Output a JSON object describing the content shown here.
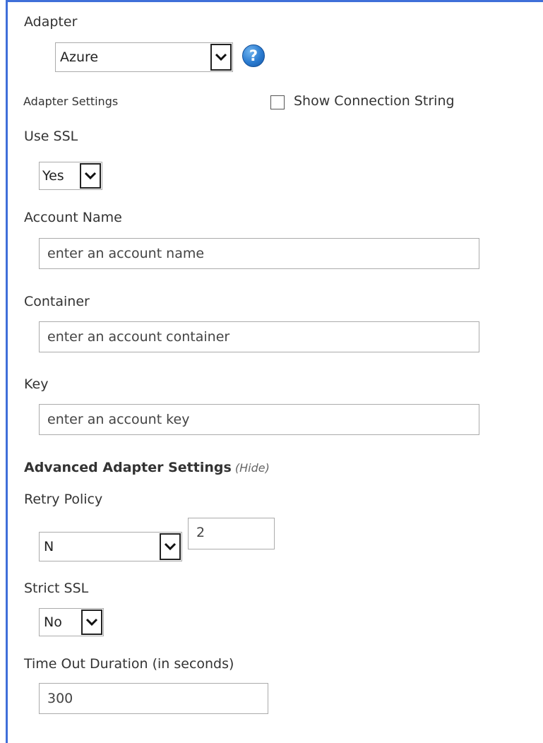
{
  "adapter": {
    "label": "Adapter",
    "selected": "Azure",
    "help_icon": "help-icon"
  },
  "adapter_settings": {
    "label": "Adapter Settings",
    "show_connection_string_label": "Show Connection String",
    "show_connection_string_checked": false
  },
  "use_ssl": {
    "label": "Use SSL",
    "selected": "Yes"
  },
  "account_name": {
    "label": "Account Name",
    "placeholder": "enter an account name"
  },
  "container": {
    "label": "Container",
    "placeholder": "enter an account container"
  },
  "key": {
    "label": "Key",
    "placeholder": "enter an account key"
  },
  "advanced": {
    "heading": "Advanced Adapter Settings",
    "toggle_label": "(Hide)"
  },
  "retry_policy": {
    "label": "Retry Policy",
    "selected": "N",
    "count_value": "2"
  },
  "strict_ssl": {
    "label": "Strict SSL",
    "selected": "No"
  },
  "timeout": {
    "label": "Time Out Duration (in seconds)",
    "value": "300"
  },
  "colors": {
    "frame_accent": "#3f6fd9",
    "help_icon_blue": "#2a7bd0"
  }
}
